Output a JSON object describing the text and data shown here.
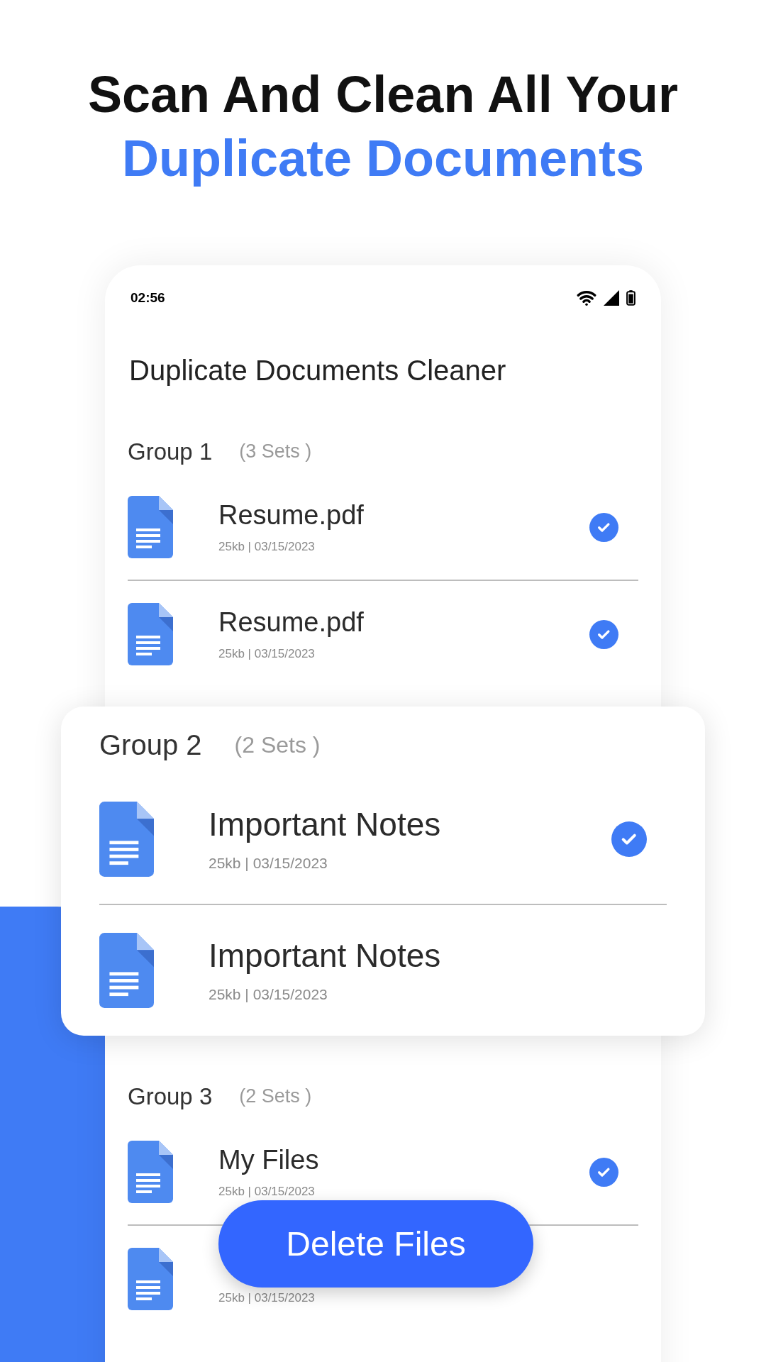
{
  "headline": {
    "line_1": "Scan And Clean All Your",
    "line_2": "Duplicate Documents"
  },
  "status_bar": {
    "time": "02:56"
  },
  "app_title": "Duplicate Documents Cleaner",
  "groups": [
    {
      "label": "Group 1",
      "count": "(3 Sets )",
      "kind": "plain",
      "files": [
        {
          "name": "Resume.pdf",
          "meta": "25kb | 03/15/2023",
          "checked": true
        },
        {
          "name": "Resume.pdf",
          "meta": "25kb | 03/15/2023",
          "checked": true
        }
      ]
    },
    {
      "label": "Group 2",
      "count": "(2 Sets )",
      "kind": "raised",
      "files": [
        {
          "name": "Important Notes",
          "meta": "25kb | 03/15/2023",
          "checked": true
        },
        {
          "name": "Important Notes",
          "meta": "25kb | 03/15/2023",
          "checked": false
        }
      ]
    },
    {
      "label": "Group 3",
      "count": "(2 Sets )",
      "kind": "plain",
      "files": [
        {
          "name": "My Files",
          "meta": "25kb | 03/15/2023",
          "checked": true
        },
        {
          "meta": "25kb | 03/15/2023",
          "checked": false
        }
      ]
    }
  ],
  "delete_button": "Delete Files"
}
